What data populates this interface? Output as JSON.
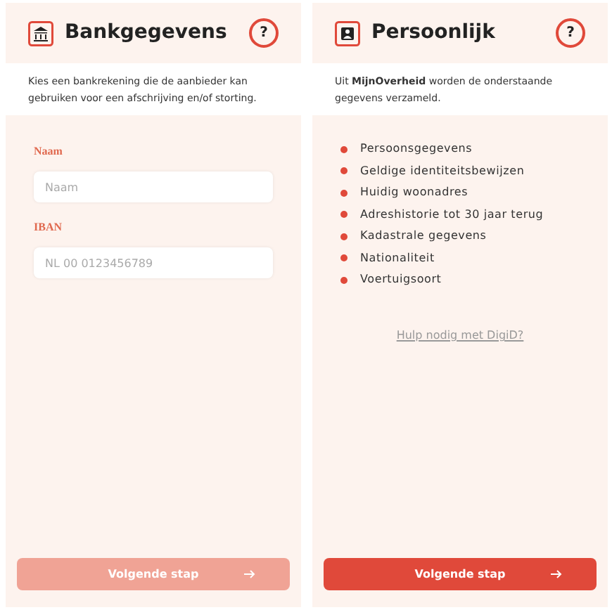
{
  "screens": [
    {
      "title": "Bankgegevens",
      "kind": "bank",
      "help": "?",
      "description": "Kies een bankrekening die de aanbieder kan gebruiken voor een afschrijving en/of storting.",
      "fields": [
        {
          "label": "Naam",
          "placeholder": "Naam"
        },
        {
          "label": "IBAN",
          "placeholder": "NL 00 0123456789"
        }
      ],
      "button": {
        "label": "Volgende stap",
        "disabled": true
      }
    },
    {
      "title": "Persoonlijk",
      "kind": "person",
      "help": "?",
      "description": "Uit **MijnOverheid** worden de onderstaande gegevens verzameld.",
      "items": [
        "Persoonsgegevens",
        "Geldige identiteitsbewijzen",
        "Huidig woonadres",
        "Adreshistorie tot 30 jaar terug",
        "Kadastrale gegevens",
        "Nationaliteit",
        "Voertuigsoort"
      ],
      "help_link": "Hulp nodig met DigiD?",
      "button": {
        "label": "Volgende stap",
        "disabled": false
      }
    }
  ]
}
